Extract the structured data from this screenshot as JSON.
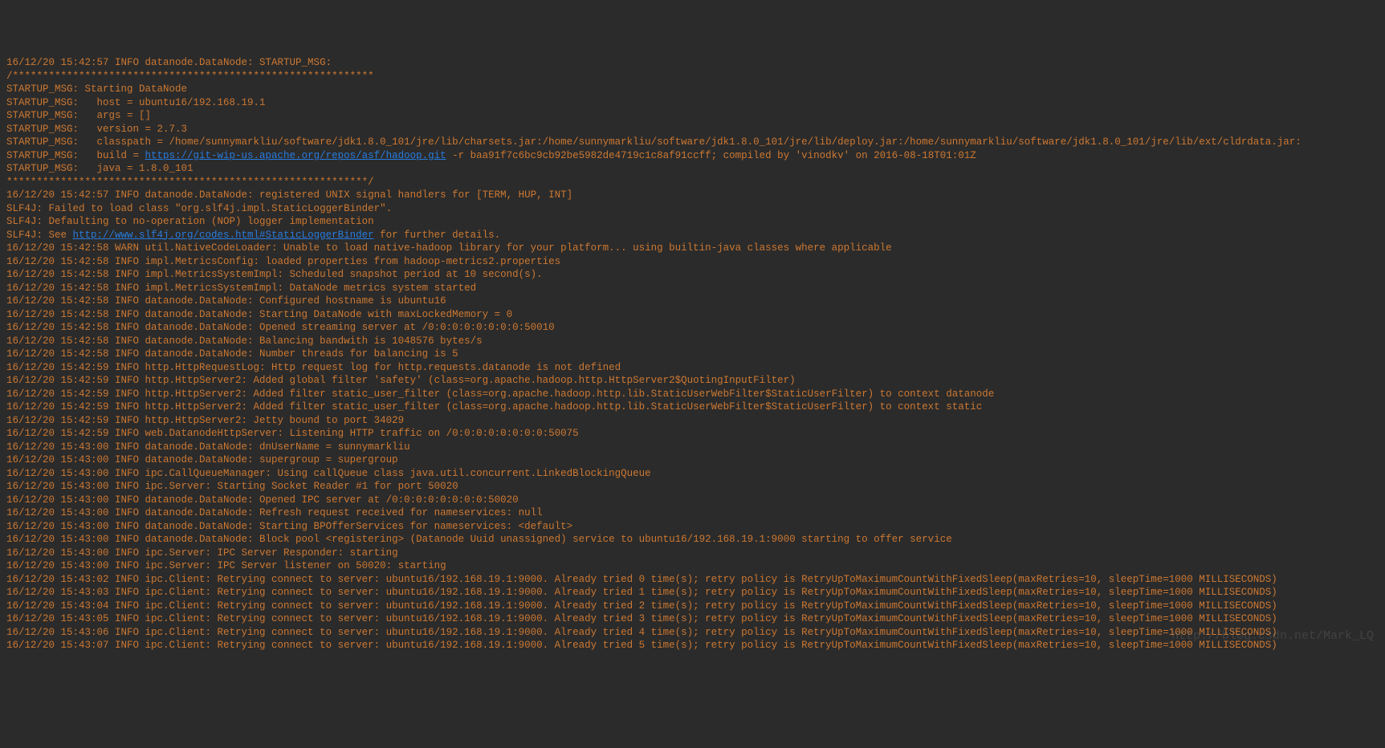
{
  "log": {
    "link_build": "https://git-wip-us.apache.org/repos/asf/hadoop.git",
    "link_slf4j": "http://www.slf4j.org/codes.html#StaticLoggerBinder",
    "lines": [
      "16/12/20 15:42:57 INFO datanode.DataNode: STARTUP_MSG:",
      "/************************************************************",
      "STARTUP_MSG: Starting DataNode",
      "STARTUP_MSG:   host = ubuntu16/192.168.19.1",
      "STARTUP_MSG:   args = []",
      "STARTUP_MSG:   version = 2.7.3",
      "STARTUP_MSG:   classpath = /home/sunnymarkliu/software/jdk1.8.0_101/jre/lib/charsets.jar:/home/sunnymarkliu/software/jdk1.8.0_101/jre/lib/deploy.jar:/home/sunnymarkliu/software/jdk1.8.0_101/jre/lib/ext/cldrdata.jar:",
      "STARTUP_MSG:   build = {{LINK_BUILD}} -r baa91f7c6bc9cb92be5982de4719c1c8af91ccff; compiled by 'vinodkv' on 2016-08-18T01:01Z",
      "STARTUP_MSG:   java = 1.8.0_101",
      "************************************************************/",
      "16/12/20 15:42:57 INFO datanode.DataNode: registered UNIX signal handlers for [TERM, HUP, INT]",
      "SLF4J: Failed to load class \"org.slf4j.impl.StaticLoggerBinder\".",
      "SLF4J: Defaulting to no-operation (NOP) logger implementation",
      "SLF4J: See {{LINK_SLF4J}} for further details.",
      "16/12/20 15:42:58 WARN util.NativeCodeLoader: Unable to load native-hadoop library for your platform... using builtin-java classes where applicable",
      "16/12/20 15:42:58 INFO impl.MetricsConfig: loaded properties from hadoop-metrics2.properties",
      "16/12/20 15:42:58 INFO impl.MetricsSystemImpl: Scheduled snapshot period at 10 second(s).",
      "16/12/20 15:42:58 INFO impl.MetricsSystemImpl: DataNode metrics system started",
      "16/12/20 15:42:58 INFO datanode.DataNode: Configured hostname is ubuntu16",
      "16/12/20 15:42:58 INFO datanode.DataNode: Starting DataNode with maxLockedMemory = 0",
      "16/12/20 15:42:58 INFO datanode.DataNode: Opened streaming server at /0:0:0:0:0:0:0:0:50010",
      "16/12/20 15:42:58 INFO datanode.DataNode: Balancing bandwith is 1048576 bytes/s",
      "16/12/20 15:42:58 INFO datanode.DataNode: Number threads for balancing is 5",
      "16/12/20 15:42:59 INFO http.HttpRequestLog: Http request log for http.requests.datanode is not defined",
      "16/12/20 15:42:59 INFO http.HttpServer2: Added global filter 'safety' (class=org.apache.hadoop.http.HttpServer2$QuotingInputFilter)",
      "16/12/20 15:42:59 INFO http.HttpServer2: Added filter static_user_filter (class=org.apache.hadoop.http.lib.StaticUserWebFilter$StaticUserFilter) to context datanode",
      "16/12/20 15:42:59 INFO http.HttpServer2: Added filter static_user_filter (class=org.apache.hadoop.http.lib.StaticUserWebFilter$StaticUserFilter) to context static",
      "16/12/20 15:42:59 INFO http.HttpServer2: Jetty bound to port 34029",
      "16/12/20 15:42:59 INFO web.DatanodeHttpServer: Listening HTTP traffic on /0:0:0:0:0:0:0:0:50075",
      "16/12/20 15:43:00 INFO datanode.DataNode: dnUserName = sunnymarkliu",
      "16/12/20 15:43:00 INFO datanode.DataNode: supergroup = supergroup",
      "16/12/20 15:43:00 INFO ipc.CallQueueManager: Using callQueue class java.util.concurrent.LinkedBlockingQueue",
      "16/12/20 15:43:00 INFO ipc.Server: Starting Socket Reader #1 for port 50020",
      "16/12/20 15:43:00 INFO datanode.DataNode: Opened IPC server at /0:0:0:0:0:0:0:0:50020",
      "16/12/20 15:43:00 INFO datanode.DataNode: Refresh request received for nameservices: null",
      "16/12/20 15:43:00 INFO datanode.DataNode: Starting BPOfferServices for nameservices: <default>",
      "16/12/20 15:43:00 INFO datanode.DataNode: Block pool <registering> (Datanode Uuid unassigned) service to ubuntu16/192.168.19.1:9000 starting to offer service",
      "16/12/20 15:43:00 INFO ipc.Server: IPC Server Responder: starting",
      "16/12/20 15:43:00 INFO ipc.Server: IPC Server listener on 50020: starting",
      "16/12/20 15:43:02 INFO ipc.Client: Retrying connect to server: ubuntu16/192.168.19.1:9000. Already tried 0 time(s); retry policy is RetryUpToMaximumCountWithFixedSleep(maxRetries=10, sleepTime=1000 MILLISECONDS)",
      "16/12/20 15:43:03 INFO ipc.Client: Retrying connect to server: ubuntu16/192.168.19.1:9000. Already tried 1 time(s); retry policy is RetryUpToMaximumCountWithFixedSleep(maxRetries=10, sleepTime=1000 MILLISECONDS)",
      "16/12/20 15:43:04 INFO ipc.Client: Retrying connect to server: ubuntu16/192.168.19.1:9000. Already tried 2 time(s); retry policy is RetryUpToMaximumCountWithFixedSleep(maxRetries=10, sleepTime=1000 MILLISECONDS)",
      "16/12/20 15:43:05 INFO ipc.Client: Retrying connect to server: ubuntu16/192.168.19.1:9000. Already tried 3 time(s); retry policy is RetryUpToMaximumCountWithFixedSleep(maxRetries=10, sleepTime=1000 MILLISECONDS)",
      "16/12/20 15:43:06 INFO ipc.Client: Retrying connect to server: ubuntu16/192.168.19.1:9000. Already tried 4 time(s); retry policy is RetryUpToMaximumCountWithFixedSleep(maxRetries=10, sleepTime=1000 MILLISECONDS)",
      "16/12/20 15:43:07 INFO ipc.Client: Retrying connect to server: ubuntu16/192.168.19.1:9000. Already tried 5 time(s); retry policy is RetryUpToMaximumCountWithFixedSleep(maxRetries=10, sleepTime=1000 MILLISECONDS)"
    ]
  },
  "watermark": "http://blog.csdn.net/Mark_LQ"
}
